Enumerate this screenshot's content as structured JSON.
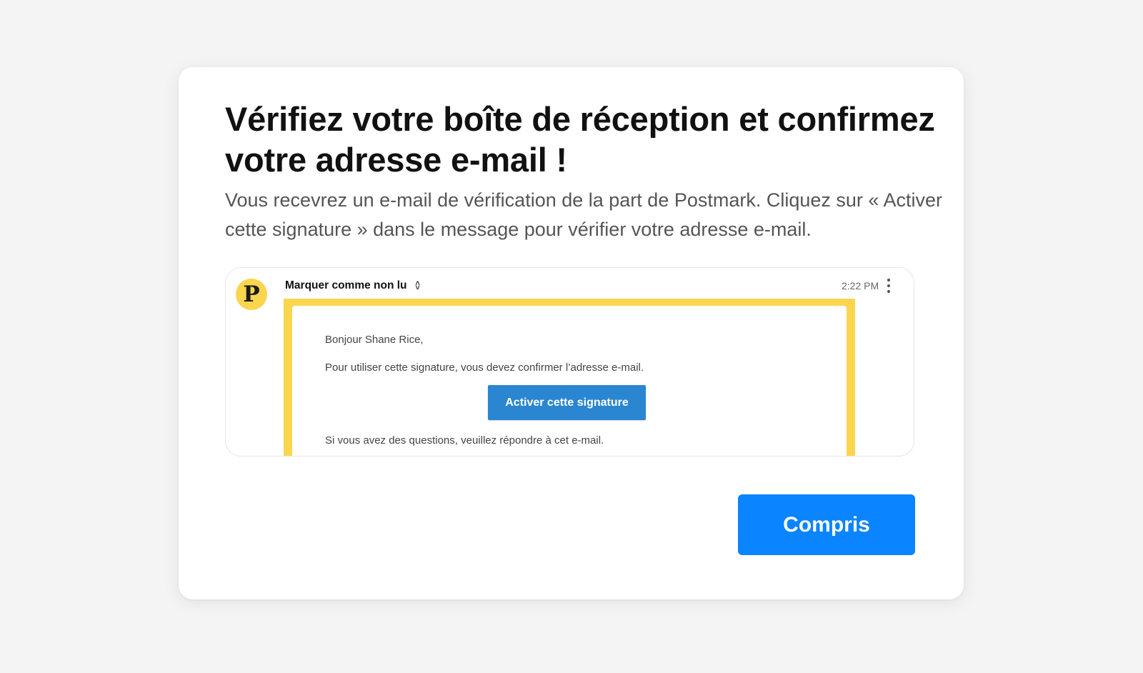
{
  "dialog": {
    "title": "Vérifiez votre boîte de réception et confirmez votre adresse e-mail !",
    "subtitle": "Vous recevrez un e-mail de vérification de la part de Postmark. Cliquez sur « Activer cette signature » dans le message pour vérifier votre adresse e-mail.",
    "confirm_label": "Compris"
  },
  "email_preview": {
    "avatar_letter": "P",
    "action_label": "Marquer comme non lu",
    "time": "2:22 PM",
    "greeting": "Bonjour Shane Rice,",
    "instructions": "Pour utiliser cette signature, vous devez confirmer l’adresse e-mail.",
    "activate_label": "Activer cette signature",
    "questions": "Si vous avez des questions, veuillez répondre à cet e-mail."
  },
  "icons": {
    "sort": "up-down-chevron-icon",
    "more": "vertical-ellipsis-icon"
  },
  "colors": {
    "accent": "#0a84ff",
    "highlight": "#fbd54e",
    "email_button": "#2a86d1"
  }
}
